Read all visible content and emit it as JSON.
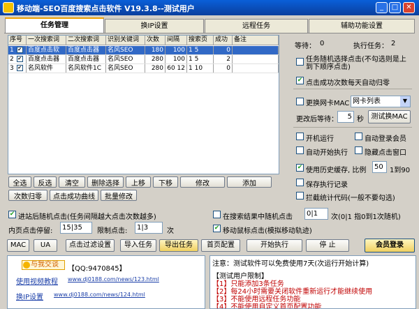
{
  "window": {
    "title": "移动端-SEO百度搜索点击软件 V19.3.8--测试用户",
    "min": "_",
    "max": "□",
    "close": "✕"
  },
  "tabs": [
    "任务管理",
    "换IP设置",
    "远程任务",
    "辅助功能设置"
  ],
  "grid": {
    "columns": [
      "序号",
      "一次搜索词",
      "二次搜索词",
      "识别关键词",
      "次数",
      "间隔",
      "搜索页",
      "成功",
      "备注"
    ],
    "rows": [
      {
        "no": "1",
        "checked": true,
        "q1": "百度点击软",
        "q2": "百度点击器",
        "kw": "名风SEO",
        "count": "180",
        "interval": "100",
        "page": "1 5",
        "success": "0",
        "note": ""
      },
      {
        "no": "2",
        "checked": true,
        "q1": "百度点击器",
        "q2": "百度点击器",
        "kw": "名风SEO",
        "count": "280",
        "interval": "100",
        "page": "1 5",
        "success": "2",
        "note": ""
      },
      {
        "no": "3",
        "checked": true,
        "q1": "名风软件",
        "q2": "名风软件1C",
        "kw": "名风SEO",
        "count": "280",
        "interval": "60 12",
        "page": "1 10",
        "success": "0",
        "note": ""
      }
    ]
  },
  "buttons": {
    "select_all": "全选",
    "invert": "反选",
    "clear": "清空",
    "delete_sel": "删除选择",
    "up": "上移",
    "down": "下移",
    "modify": "修改",
    "add": "添加",
    "reset_count": "次数归零",
    "click_curve": "点击成功曲线",
    "batch_modify": "批量修改",
    "mac": "MAC",
    "ua": "UA",
    "filter": "点击过滤设置",
    "import": "导入任务",
    "export": "导出任务",
    "homepage": "首页配置",
    "start": "开始执行",
    "stop": "停 止",
    "login": "会员登录",
    "test_mac": "测试换MAC"
  },
  "options": {
    "inner_random": "进站后随机点击(任务间隔越大点击次数越多)",
    "inner_wait_label": "内页点击停留:",
    "inner_wait_value": "15|35",
    "limit_label": "限制点击:",
    "limit_value": "1|3",
    "limit_unit": "次",
    "search_random": "在搜索结果中随机点击",
    "search_random_value": "0|1",
    "search_random_hint": "次(0|1 指0到1次随机)",
    "mouse_move": "移动鼠标点击(模拟移动轨迹)"
  },
  "right": {
    "waiting_label": "等待：",
    "waiting_value": "0",
    "done_label": "执行任务：",
    "done_value": "2",
    "random_task": "任务随机选择点击(不勾选则是上到下顺序点击)",
    "reset_daily": "点击成功次数每天自动归零",
    "change_nic": "更换网卡MAC",
    "nic_select": "网卡列表",
    "wait_label": "更改后等待：",
    "wait_value": "5",
    "wait_unit": "秒",
    "autostart": "开机运行",
    "autologin": "自动登录会员",
    "autoexec": "自动开始执行",
    "hide_window": "隐藏点击窗口",
    "history_label": "使用历史缓存, 比例",
    "history_value": "50",
    "history_range": "1到90",
    "save_log": "保存执行记录",
    "block_stats": "拦截统计代码(一般不要勾选)"
  },
  "footer": {
    "promo_title": "与我交谈",
    "qq": "【QQ:9470845】",
    "video_label": "使用视频教程",
    "video_url": "www.dj0188.com/news/123.html",
    "ip_label": "换IP设置",
    "ip_url": "www.dj0188.com/news/124.html",
    "notice_title": "注意：测试软件可以免费使用7天(次运行开始计算)",
    "notice_section": "【测试用户限制】",
    "notice_items": [
      "【1】只能添加3条任务",
      "【2】每24小时需要关闭软件重新运行才能继续使用",
      "【3】不能使用远程任务功能",
      "【4】不能使用自定义首页配置功能"
    ]
  },
  "colors": {
    "titlebar": "#0a4fb8",
    "accent": "#f0a000",
    "selection": "#3169c6",
    "notice_red": "#c00000"
  }
}
